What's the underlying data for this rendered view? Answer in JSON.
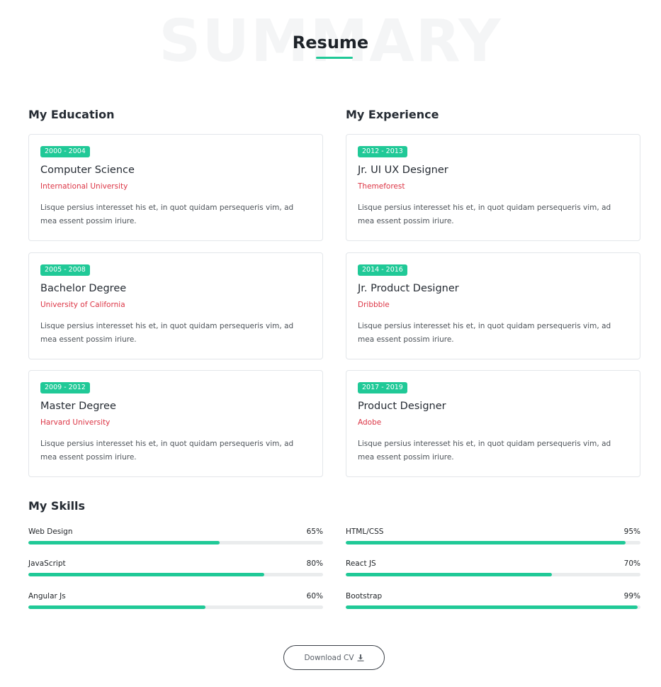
{
  "header": {
    "bg_title": "SUMMARY",
    "title": "Resume"
  },
  "education": {
    "heading": "My Education",
    "items": [
      {
        "years": "2000 - 2004",
        "title": "Computer Science",
        "place": "International University",
        "desc": "Lisque persius interesset his et, in quot quidam persequeris vim, ad mea essent possim iriure."
      },
      {
        "years": "2005 - 2008",
        "title": "Bachelor Degree",
        "place": "University of California",
        "desc": "Lisque persius interesset his et, in quot quidam persequeris vim, ad mea essent possim iriure."
      },
      {
        "years": "2009 - 2012",
        "title": "Master Degree",
        "place": "Harvard University",
        "desc": "Lisque persius interesset his et, in quot quidam persequeris vim, ad mea essent possim iriure."
      }
    ]
  },
  "experience": {
    "heading": "My Experience",
    "items": [
      {
        "years": "2012 - 2013",
        "title": "Jr. UI UX Designer",
        "place": "Themeforest",
        "desc": "Lisque persius interesset his et, in quot quidam persequeris vim, ad mea essent possim iriure."
      },
      {
        "years": "2014 - 2016",
        "title": "Jr. Product Designer",
        "place": "Dribbble",
        "desc": "Lisque persius interesset his et, in quot quidam persequeris vim, ad mea essent possim iriure."
      },
      {
        "years": "2017 - 2019",
        "title": "Product Designer",
        "place": "Adobe",
        "desc": "Lisque persius interesset his et, in quot quidam persequeris vim, ad mea essent possim iriure."
      }
    ]
  },
  "skills": {
    "heading": "My Skills",
    "left": [
      {
        "name": "Web Design",
        "percent_label": "65%",
        "percent": 65
      },
      {
        "name": "JavaScript",
        "percent_label": "80%",
        "percent": 80
      },
      {
        "name": "Angular Js",
        "percent_label": "60%",
        "percent": 60
      }
    ],
    "right": [
      {
        "name": "HTML/CSS",
        "percent_label": "95%",
        "percent": 95
      },
      {
        "name": "React JS",
        "percent_label": "70%",
        "percent": 70
      },
      {
        "name": "Bootstrap",
        "percent_label": "99%",
        "percent": 99
      }
    ]
  },
  "download": {
    "label": "Download CV",
    "icon": "download-icon"
  },
  "colors": {
    "accent": "#20c997",
    "place": "#dc3545"
  }
}
